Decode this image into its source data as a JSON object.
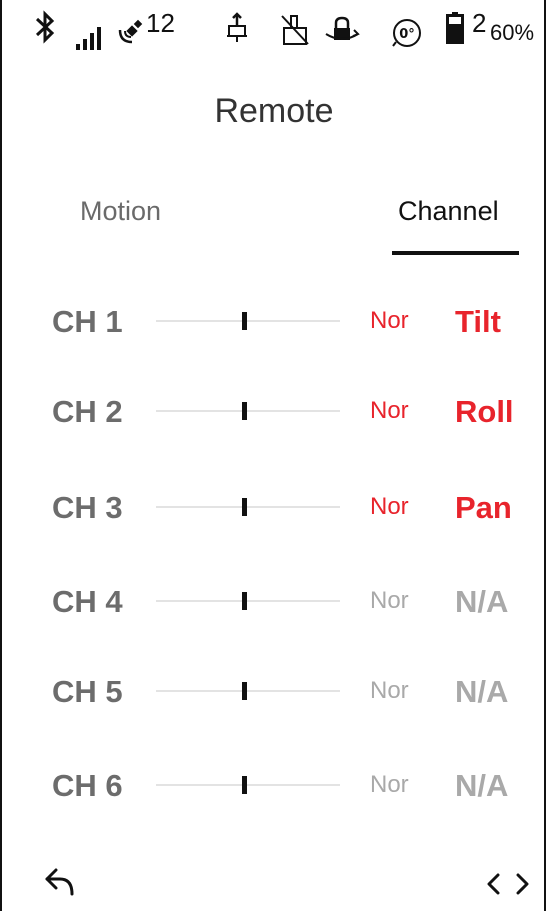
{
  "status_bar": {
    "gps_count": "12",
    "battery_index": "2",
    "battery_percent": "60%",
    "rotation_badge": "0°"
  },
  "page": {
    "title": "Remote"
  },
  "tabs": [
    {
      "label": "Motion",
      "selected": false
    },
    {
      "label": "Channel",
      "selected": true
    }
  ],
  "channels": [
    {
      "label": "CH 1",
      "mode": "Nor",
      "function": "Tilt",
      "active": true
    },
    {
      "label": "CH 2",
      "mode": "Nor",
      "function": "Roll",
      "active": true
    },
    {
      "label": "CH 3",
      "mode": "Nor",
      "function": "Pan",
      "active": true
    },
    {
      "label": "CH 4",
      "mode": "Nor",
      "function": "N/A",
      "active": false
    },
    {
      "label": "CH 5",
      "mode": "Nor",
      "function": "N/A",
      "active": false
    },
    {
      "label": "CH 6",
      "mode": "Nor",
      "function": "N/A",
      "active": false
    }
  ],
  "colors": {
    "active": "#e8242c",
    "inactive": "#a9a9a9",
    "label": "#6c6c6c"
  },
  "icons": {
    "back": "back-arrow-icon",
    "code": "code-brackets-icon"
  }
}
